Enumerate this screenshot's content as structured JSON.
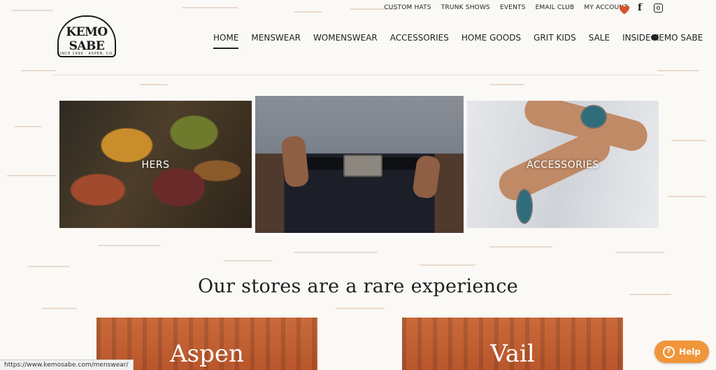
{
  "util_nav": [
    "CUSTOM HATS",
    "TRUNK SHOWS",
    "EVENTS",
    "EMAIL CLUB",
    "MY ACCOUNT"
  ],
  "icons": {
    "wishlist": "heart-icon",
    "facebook": "facebook-icon",
    "instagram": "instagram-icon",
    "chat": "chat-icon"
  },
  "colors": {
    "accent": "#f0953a",
    "heart": "#d9542a",
    "store_tile": "#c96a3a"
  },
  "logo": {
    "name": "KEMO SABE",
    "sub": "SINCE 1990 · ASPEN, CO."
  },
  "main_nav": [
    "HOME",
    "MENSWEAR",
    "WOMENSWEAR",
    "ACCESSORIES",
    "HOME GOODS",
    "GRIT KIDS",
    "SALE",
    "INSIDE KEMO SABE"
  ],
  "tiles": {
    "hers": "HERS",
    "accessories": "ACCESSORIES"
  },
  "headline": "Our stores are a rare experience",
  "stores": {
    "aspen": "Aspen",
    "vail": "Vail"
  },
  "status_url": "https://www.kemosabe.com/menswear/",
  "help": {
    "label": "Help"
  }
}
